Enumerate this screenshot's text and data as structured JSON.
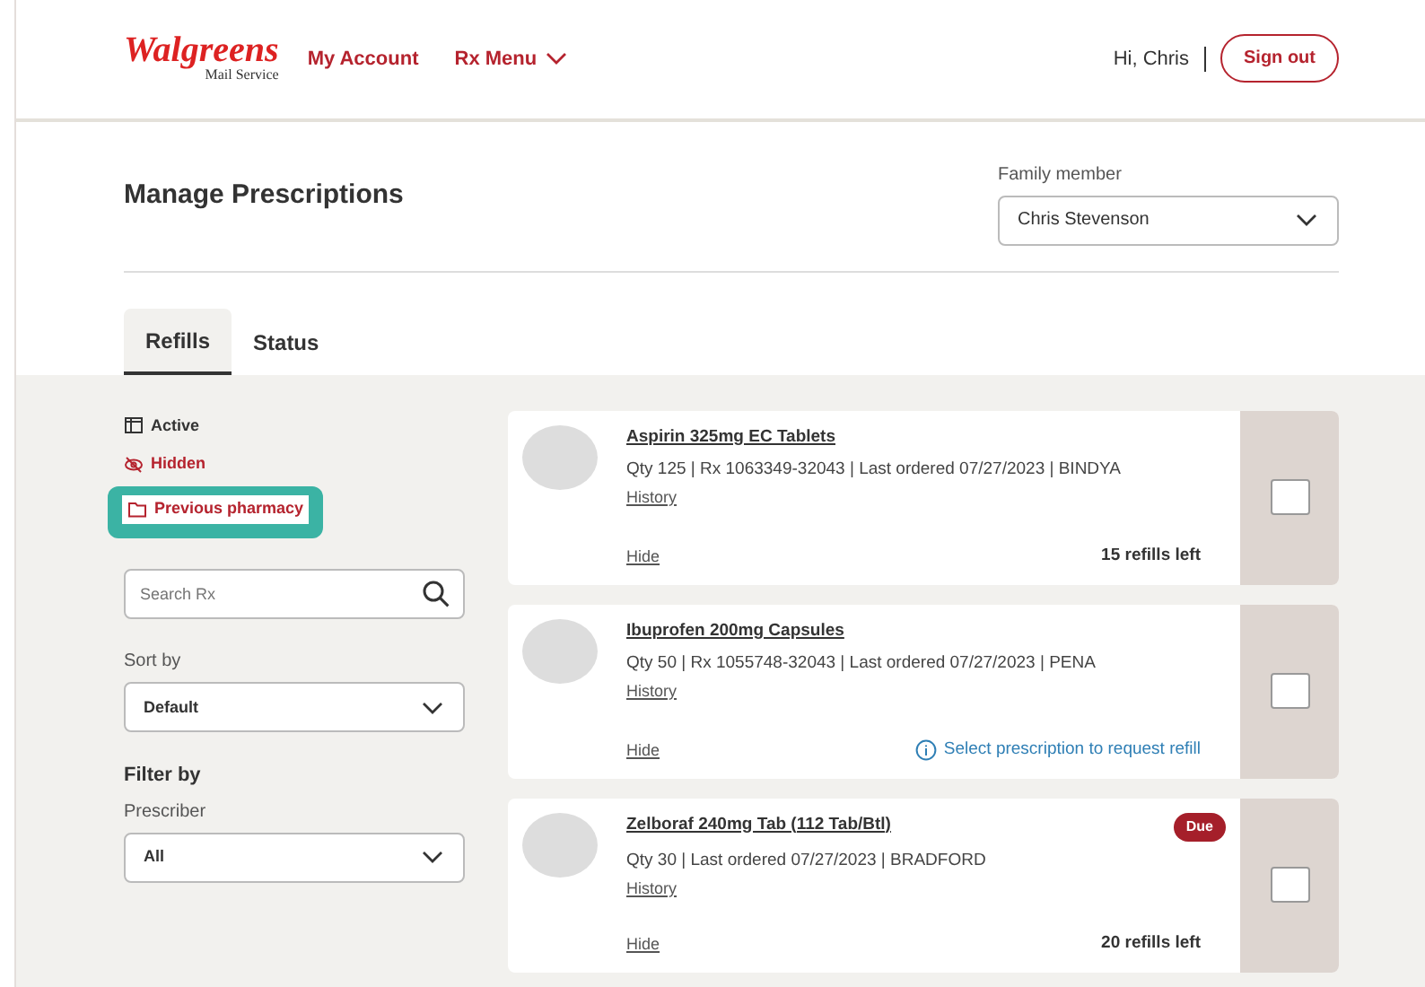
{
  "header": {
    "logo": "Walgreens",
    "logo_sub": "Mail Service",
    "nav": [
      {
        "label": "My Account",
        "dropdown": false
      },
      {
        "label": "Rx Menu",
        "dropdown": true
      }
    ],
    "greeting": "Hi, Chris",
    "sign_out": "Sign out"
  },
  "page": {
    "title": "Manage Prescriptions",
    "family_label": "Family member",
    "family_value": "Chris Stevenson"
  },
  "tabs": [
    {
      "label": "Refills",
      "selected": true
    },
    {
      "label": "Status",
      "selected": false
    }
  ],
  "sidebar": {
    "views": [
      {
        "label": "Active",
        "kind": "active",
        "selected": true,
        "highlighted": false
      },
      {
        "label": "Hidden",
        "kind": "hidden",
        "selected": false,
        "highlighted": false
      },
      {
        "label": "Previous pharmacy",
        "kind": "folder",
        "selected": false,
        "highlighted": true
      }
    ],
    "search": {
      "placeholder": "Search Rx"
    },
    "sort_label": "Sort by",
    "sort_value": "Default",
    "filter_heading": "Filter by",
    "prescriber_label": "Prescriber",
    "prescriber_value": "All"
  },
  "prescriptions": [
    {
      "name": "Aspirin 325mg EC Tablets",
      "details": "Qty 125 | Rx 1063349-32043 | Last ordered 07/27/2023 | BINDYA",
      "history": "History",
      "hide": "Hide",
      "footer": "15 refills left",
      "kind": "refills",
      "checked": false
    },
    {
      "name": "Ibuprofen 200mg Capsules",
      "details": "Qty 50 | Rx 1055748-32043 | Last ordered 07/27/2023 | PENA",
      "history": "History",
      "hide": "Hide",
      "footer": "Select prescription to request refill",
      "kind": "info",
      "checked": false
    },
    {
      "name": "Zelboraf 240mg Tab (112 Tab/Btl)",
      "badge": "Due",
      "details": "Qty 30 | Last ordered 07/27/2023 | BRADFORD",
      "history": "History",
      "hide": "Hide",
      "footer": "20 refills left",
      "kind": "refills",
      "checked": false
    }
  ]
}
